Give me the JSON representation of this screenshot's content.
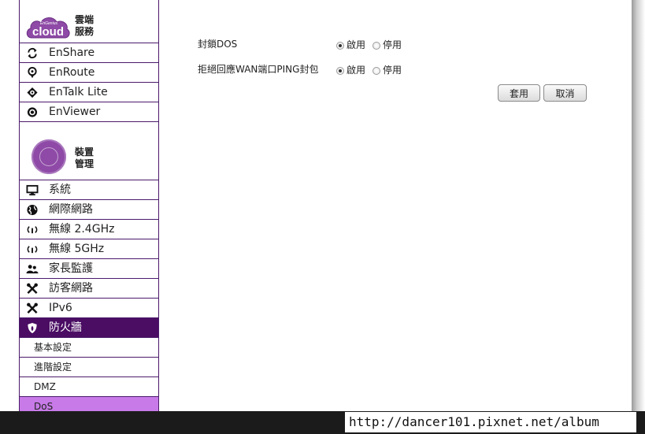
{
  "sidebar": {
    "cloud": {
      "logo_text_small": "EnGenius",
      "logo_text": "cloud",
      "title_line1": "雲端",
      "title_line2": "服務",
      "items": [
        {
          "label": "EnShare",
          "icon": "sync-icon"
        },
        {
          "label": "EnRoute",
          "icon": "location-pin-icon"
        },
        {
          "label": "EnTalk Lite",
          "icon": "talk-icon"
        },
        {
          "label": "EnViewer",
          "icon": "camera-lens-icon"
        }
      ]
    },
    "device": {
      "title_line1": "裝置",
      "title_line2": "管理",
      "items": [
        {
          "label": "系統",
          "icon": "monitor-icon"
        },
        {
          "label": "網際網路",
          "icon": "globe-icon"
        },
        {
          "label": "無線 2.4GHz",
          "icon": "wireless-icon"
        },
        {
          "label": "無線 5GHz",
          "icon": "wireless-icon"
        },
        {
          "label": "家長監護",
          "icon": "users-icon"
        },
        {
          "label": "訪客網路",
          "icon": "tools-icon"
        },
        {
          "label": "IPv6",
          "icon": "tools-icon"
        },
        {
          "label": "防火牆",
          "icon": "shield-icon"
        }
      ],
      "firewall_sub": [
        {
          "label": "基本設定"
        },
        {
          "label": "進階設定"
        },
        {
          "label": "DMZ"
        },
        {
          "label": "DoS"
        }
      ]
    }
  },
  "form": {
    "rows": [
      {
        "label": "封鎖DOS",
        "enable": "啟用",
        "disable": "停用",
        "selected": "enable"
      },
      {
        "label": "拒絕回應WAN端口PING封包",
        "enable": "啟用",
        "disable": "停用",
        "selected": "enable"
      }
    ],
    "apply_label": "套用",
    "cancel_label": "取消"
  },
  "watermark": "http://dancer101.pixnet.net/album",
  "colors": {
    "sidebar_border": "#4b1a6b",
    "active_item": "#4a0d63",
    "active_sub": "#c77ae8"
  }
}
